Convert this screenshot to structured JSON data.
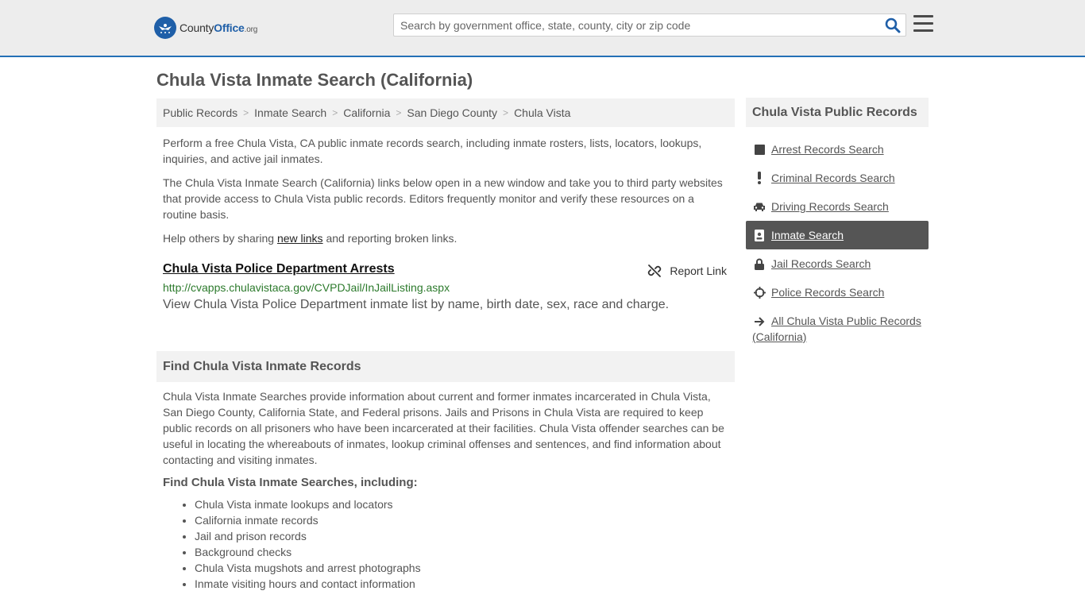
{
  "header": {
    "logo": {
      "brand_prefix": "County",
      "brand_highlight": "Office",
      "brand_suffix": ".org"
    },
    "search": {
      "placeholder": "Search by government office, state, county, city or zip code",
      "value": ""
    },
    "icons": {
      "search": "search-icon",
      "menu": "hamburger-menu-icon"
    },
    "accent_color": "#2470b6"
  },
  "page_title": "Chula Vista Inmate Search (California)",
  "breadcrumb": [
    "Public Records",
    "Inmate Search",
    "California",
    "San Diego County",
    "Chula Vista"
  ],
  "intro": {
    "p1": "Perform a free Chula Vista, CA public inmate records search, including inmate rosters, lists, locators, lookups, inquiries, and active jail inmates.",
    "p2": "The Chula Vista Inmate Search (California) links below open in a new window and take you to third party websites that provide access to Chula Vista public records. Editors frequently monitor and verify these resources on a routine basis.",
    "p3_before": "Help others by sharing ",
    "p3_link": "new links",
    "p3_after": " and reporting broken links."
  },
  "listing": {
    "title": "Chula Vista Police Department Arrests",
    "report_label": "Report Link",
    "url": "http://cvapps.chulavistaca.gov/CVPDJail/InJailListing.aspx",
    "description": "View Chula Vista Police Department inmate list by name, birth date, sex, race and charge."
  },
  "find_section": {
    "heading": "Find Chula Vista Inmate Records",
    "body": "Chula Vista Inmate Searches provide information about current and former inmates incarcerated in Chula Vista, San Diego County, California State, and Federal prisons. Jails and Prisons in Chula Vista are required to keep public records on all prisoners who have been incarcerated at their facilities. Chula Vista offender searches can be useful in locating the whereabouts of inmates, lookup criminal offenses and sentences, and find information about contacting and visiting inmates.",
    "subheading": "Find Chula Vista Inmate Searches, including:",
    "items": [
      "Chula Vista inmate lookups and locators",
      "California inmate records",
      "Jail and prison records",
      "Background checks",
      "Chula Vista mugshots and arrest photographs",
      "Inmate visiting hours and contact information"
    ]
  },
  "sidebar": {
    "heading": "Chula Vista Public Records",
    "items": [
      {
        "label": "Arrest Records Search",
        "icon": "square-icon"
      },
      {
        "label": "Criminal Records Search",
        "icon": "exclamation-icon"
      },
      {
        "label": "Driving Records Search",
        "icon": "car-icon"
      },
      {
        "label": "Inmate Search",
        "icon": "id-badge-icon",
        "active": true
      },
      {
        "label": "Jail Records Search",
        "icon": "lock-icon"
      },
      {
        "label": "Police Records Search",
        "icon": "crosshair-icon"
      },
      {
        "label": "All Chula Vista Public Records (California)",
        "icon": "arrow-right-icon"
      }
    ],
    "active_color": "#555555"
  }
}
